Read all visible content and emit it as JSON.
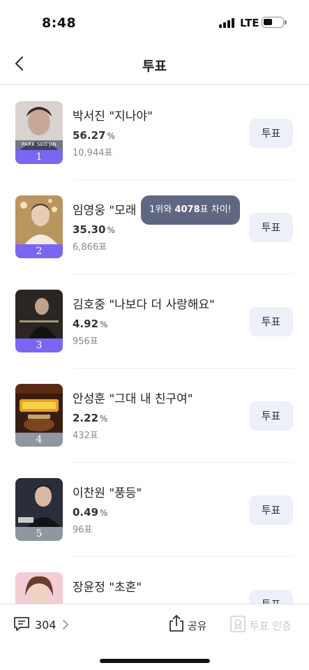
{
  "status_bar": {
    "time": "8:48",
    "network": "LTE"
  },
  "nav": {
    "title": "투표"
  },
  "colors": {
    "rank_top": "#7b66f2",
    "rank_other": "#8f97a0",
    "vote_button_bg": "#edf0f8",
    "tooltip_bg": "#5f6782"
  },
  "candidates": [
    {
      "rank": "1",
      "title": "박서진 \"지나야\"",
      "percent": "56.27",
      "percent_unit": "%",
      "votes": "10,944표",
      "button": "투표",
      "thumb_caption": "PARK SEO JIN",
      "icon": "photo-thumbnail"
    },
    {
      "rank": "2",
      "title": "임영웅 \"모래",
      "percent": "35.30",
      "percent_unit": "%",
      "votes": "6,866표",
      "button": "투표",
      "icon": "photo-thumbnail"
    },
    {
      "rank": "3",
      "title": "김호중 \"나보다 더 사랑해요\"",
      "percent": "4.92",
      "percent_unit": "%",
      "votes": "956표",
      "button": "투표",
      "icon": "photo-thumbnail"
    },
    {
      "rank": "4",
      "title": "안성훈 \"그대 내 친구여\"",
      "percent": "2.22",
      "percent_unit": "%",
      "votes": "432표",
      "button": "투표",
      "icon": "photo-thumbnail"
    },
    {
      "rank": "5",
      "title": "이찬원 \"풍등\"",
      "percent": "0.49",
      "percent_unit": "%",
      "votes": "96표",
      "button": "투표",
      "icon": "photo-thumbnail"
    },
    {
      "rank": "",
      "title": "장윤정 \"초혼\"",
      "percent": "",
      "percent_unit": "",
      "votes": "",
      "button": "투표",
      "icon": "photo-thumbnail"
    }
  ],
  "tooltip": {
    "prefix": "1위와 ",
    "diff": "4078",
    "suffix": "표 차이!"
  },
  "bottom_bar": {
    "comment_count": "304",
    "share_label": "공유",
    "certify_label": "투표 인증"
  }
}
